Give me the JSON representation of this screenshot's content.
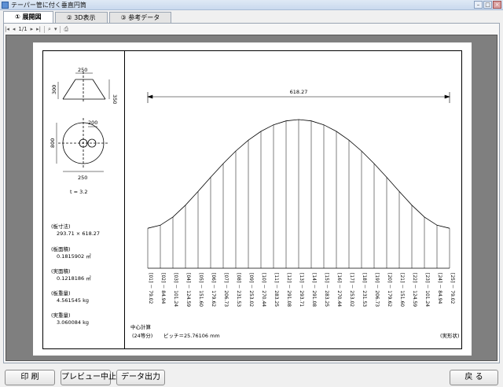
{
  "window": {
    "title": "テーパー管に付く垂直円筒"
  },
  "tabs": [
    {
      "label": "① 展開図",
      "active": true
    },
    {
      "label": "② 3D表示",
      "active": false
    },
    {
      "label": "③ 参考データ",
      "active": false
    }
  ],
  "toolbar": {
    "page_indicator": "1/1"
  },
  "diagram": {
    "taper_top": "250",
    "taper_left": "300",
    "taper_right": "350",
    "plan_branch": "200",
    "plan_height": "800",
    "plan_bottom": "250",
    "thickness": "t = 3.2",
    "plate_size_label": "(板寸法)",
    "plate_size_value": "293.71 × 618.27",
    "plate_area_label": "(板面積)",
    "plate_area_value": "0.1815902 ㎡",
    "real_area_label": "(実面積)",
    "real_area_value": "0.1218186 ㎡",
    "plate_weight_label": "(板重量)",
    "plate_weight_value": "4.561545 kg",
    "real_weight_label": "(実重量)",
    "real_weight_value": "3.060084 kg",
    "width_dim": "618.27",
    "center_calc": "中心計算",
    "divisions": "(24等分)",
    "pitch": "ピッチ＝25.76106 mm",
    "actual_shape": "(実形状)",
    "heights": [
      79.02,
      84.94,
      101.24,
      124.59,
      151.6,
      179.62,
      206.73,
      231.53,
      253.02,
      270.44,
      283.25,
      291.08,
      293.71,
      291.08,
      283.25,
      270.44,
      253.02,
      231.53,
      206.73,
      179.62,
      151.6,
      124.59,
      101.24,
      84.94,
      79.02
    ],
    "labels": [
      "[01] － 79.02",
      "[02] － 84.94",
      "[03] － 101.24",
      "[04] － 124.59",
      "[05] － 151.60",
      "[06] － 179.62",
      "[07] － 206.73",
      "[08] － 231.53",
      "[09] － 253.02",
      "[10] － 270.44",
      "[11] － 283.25",
      "[12] － 291.08",
      "[13] － 293.71",
      "[14] － 291.08",
      "[15] － 283.25",
      "[16] － 270.44",
      "[17] － 253.02",
      "[18] － 231.53",
      "[19] － 206.73",
      "[20] － 179.62",
      "[21] － 151.60",
      "[22] － 124.59",
      "[23] － 101.24",
      "[24] － 84.94",
      "[25] － 79.02"
    ]
  },
  "buttons": {
    "print": "印 刷",
    "stop_preview": "プレビュー中止",
    "export": "データ出力",
    "back": "戻 る"
  }
}
